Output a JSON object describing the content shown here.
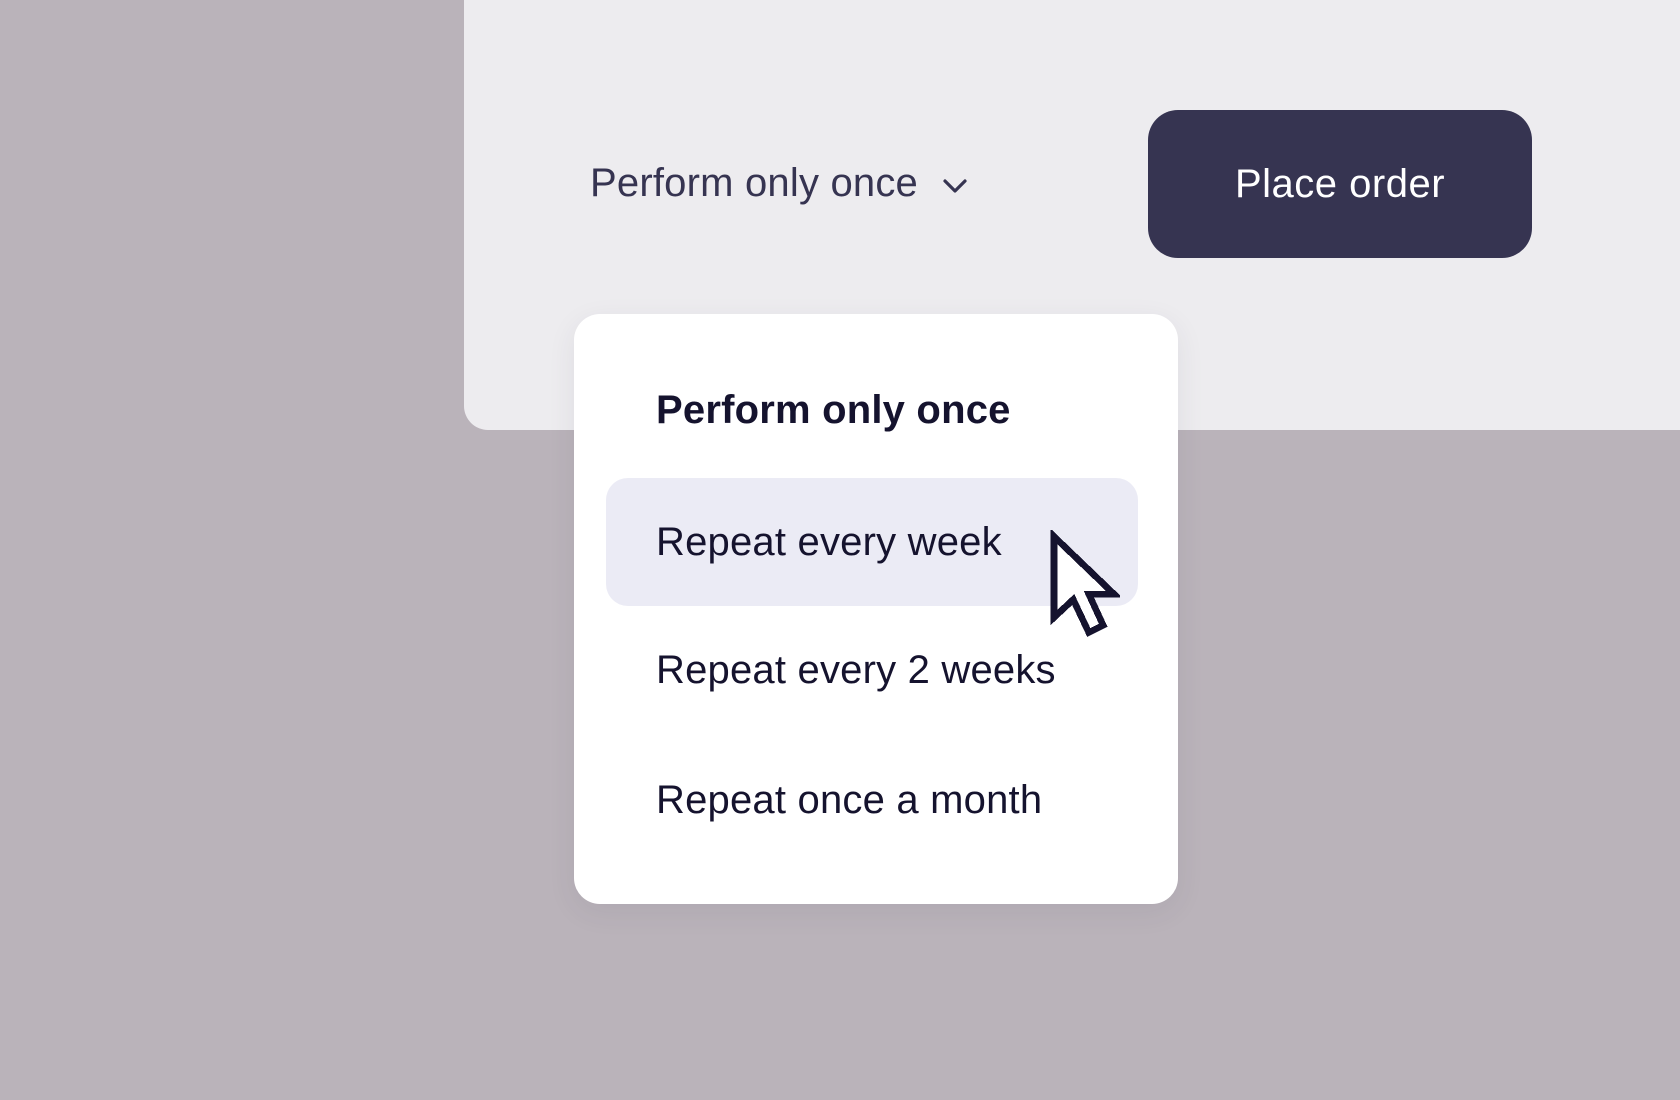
{
  "order_form": {
    "frequency_selected": "Perform only once",
    "place_order_label": "Place order"
  },
  "frequency_dropdown": {
    "state": "open",
    "hovered_index": 1,
    "options": [
      {
        "label": "Perform only once",
        "selected": true
      },
      {
        "label": "Repeat every week",
        "selected": false
      },
      {
        "label": "Repeat every 2 weeks",
        "selected": false
      },
      {
        "label": "Repeat once a month",
        "selected": false
      }
    ]
  },
  "icons": {
    "dropdown_toggle": "chevron-down-icon",
    "pointer": "mouse-cursor-icon"
  },
  "colors": {
    "page_background": "#bab3ba",
    "panel_background": "#edecef",
    "primary_button": "#363451",
    "menu_background": "#ffffff",
    "hover_background": "#ebebf5",
    "text_dark": "#15132e",
    "text_muted": "#363451"
  }
}
